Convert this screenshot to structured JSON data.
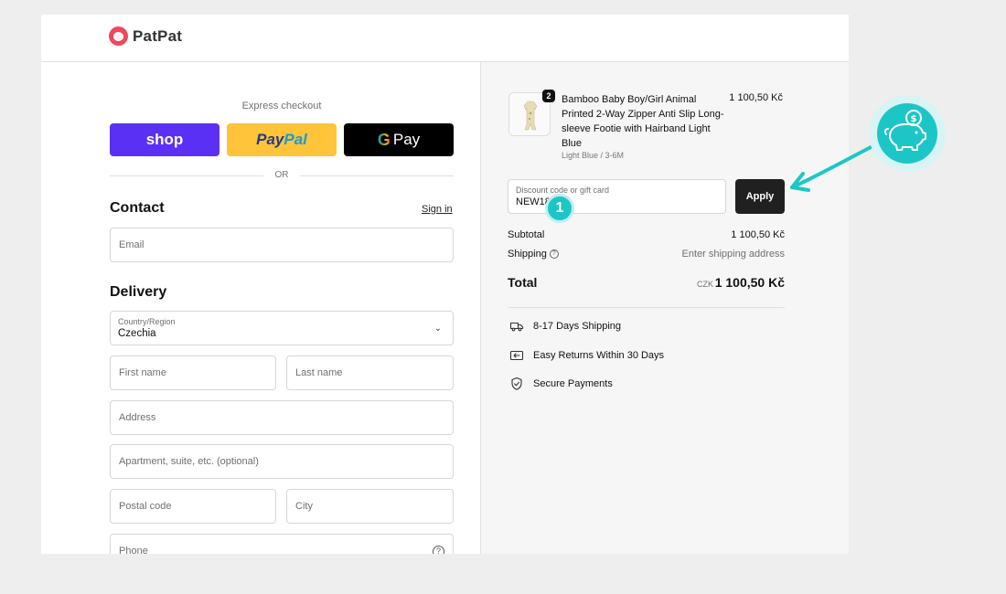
{
  "header": {
    "brand": "PatPat"
  },
  "express": {
    "title": "Express checkout",
    "shop_label": "shop",
    "paypal_pay": "Pay",
    "paypal_pal": "Pal",
    "gpay_g": "G",
    "gpay_label": "Pay",
    "or_text": "OR"
  },
  "contact": {
    "title": "Contact",
    "signin": "Sign in",
    "email_placeholder": "Email"
  },
  "delivery": {
    "title": "Delivery",
    "country_label": "Country/Region",
    "country_value": "Czechia",
    "first_name": "First name",
    "last_name": "Last name",
    "address": "Address",
    "apartment": "Apartment, suite, etc. (optional)",
    "postal_code": "Postal code",
    "city": "City",
    "phone": "Phone"
  },
  "order": {
    "item": {
      "quantity": "2",
      "title": "Bamboo Baby Boy/Girl Animal Printed 2-Way Zipper Anti Slip Long-sleeve Footie with Hairband Light Blue",
      "variant": "Light Blue / 3-6M",
      "price": "1 100,50 Kč"
    },
    "discount_label": "Discount code or gift card",
    "discount_value": "NEW18",
    "apply_label": "Apply",
    "step_number": "1",
    "subtotal_label": "Subtotal",
    "subtotal_value": "1 100,50 Kč",
    "shipping_label": "Shipping",
    "shipping_value": "Enter shipping address",
    "total_label": "Total",
    "total_currency": "CZK",
    "total_value": "1 100,50 Kč"
  },
  "features": [
    {
      "label": "8-17 Days Shipping",
      "icon": "truck-icon"
    },
    {
      "label": "Easy Returns Within 30 Days",
      "icon": "return-icon"
    },
    {
      "label": "Secure Payments",
      "icon": "shield-check-icon"
    }
  ],
  "colors": {
    "accent_teal": "#1dc6c6",
    "shop_purple": "#5a31f4",
    "paypal_yellow": "#ffc439",
    "brand_red": "#f0485a"
  }
}
